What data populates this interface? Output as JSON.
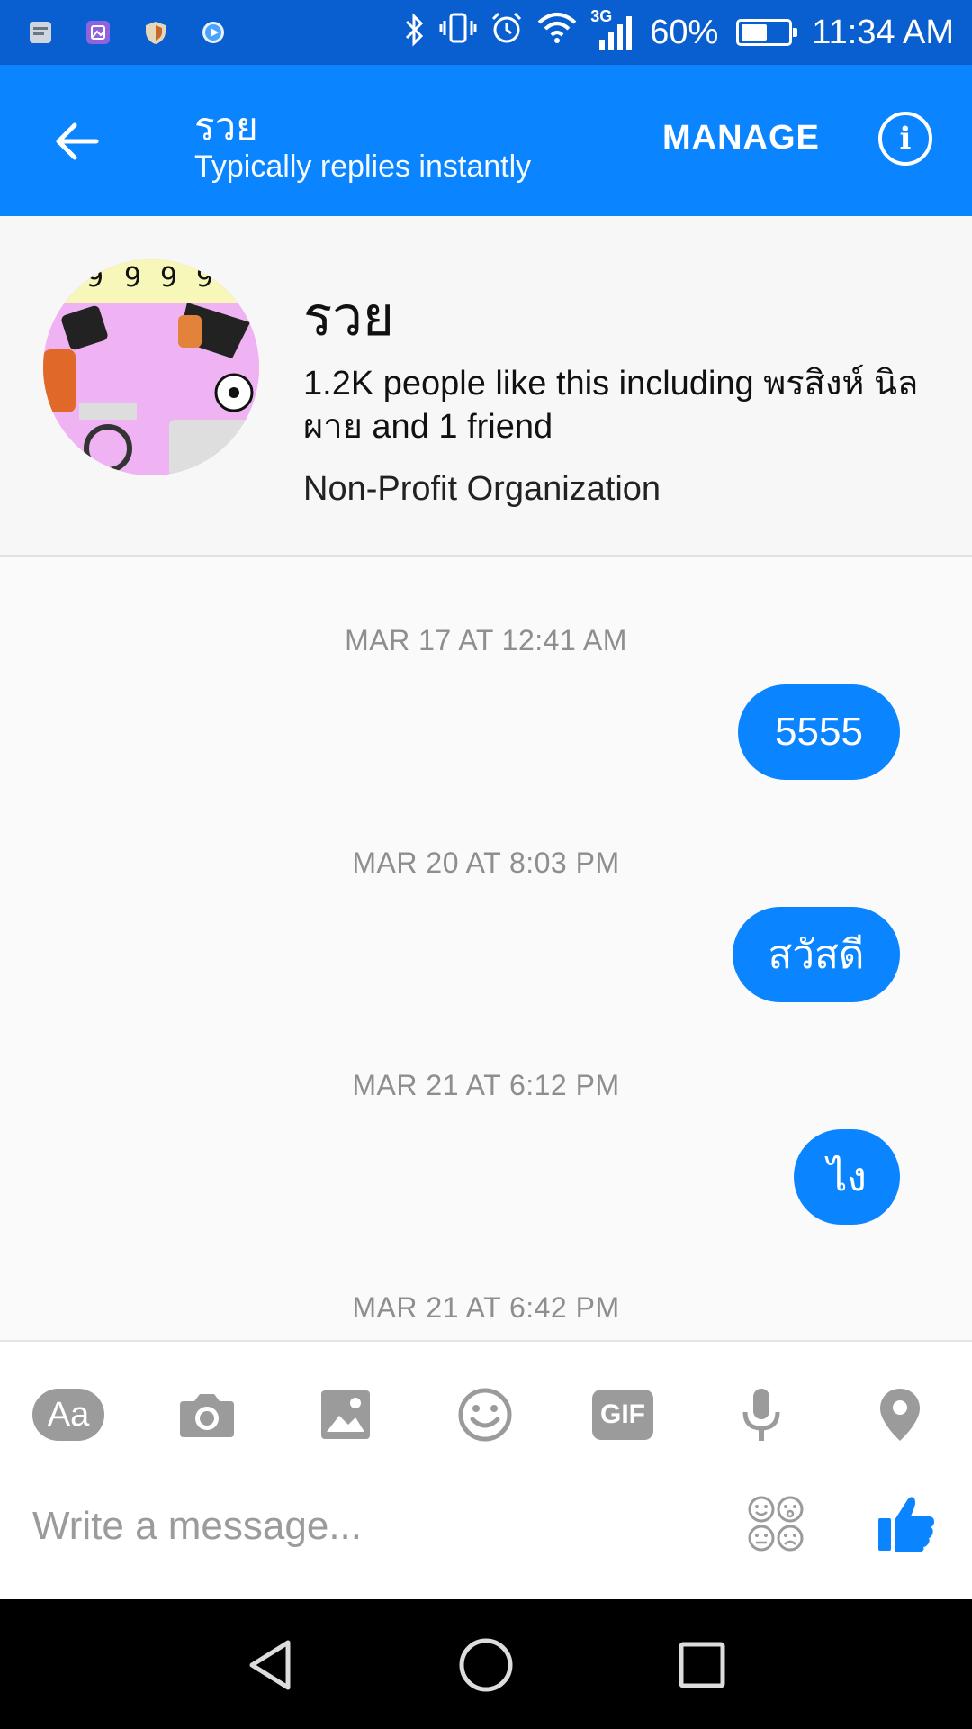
{
  "status_bar": {
    "signal_label": "3G",
    "battery": "60%",
    "battery_level": 0.6,
    "time": "11:34 AM"
  },
  "header": {
    "title": "รวย",
    "subtitle": "Typically replies instantly",
    "manage_label": "MANAGE"
  },
  "profile": {
    "name": "รวย",
    "likes": "1.2K people like this including พรสิงห์ นิลผาย and 1 friend",
    "category": "Non-Profit Organization"
  },
  "messages": [
    {
      "timestamp": "MAR 17 AT 12:41 AM",
      "text": "5555"
    },
    {
      "timestamp": "MAR 20 AT 8:03 PM",
      "text": "สวัสดี"
    },
    {
      "timestamp": "MAR 21 AT 6:12 PM",
      "text": "ไง"
    },
    {
      "timestamp": "MAR 21 AT 6:42 PM",
      "text": ""
    }
  ],
  "composer": {
    "aa_label": "Aa",
    "gif_label": "GIF",
    "placeholder": "Write a message..."
  },
  "colors": {
    "accent": "#0a84ff",
    "status_bar": "#0a5fd0",
    "icon_gray": "#9b9b9b"
  },
  "icons": {
    "back": "arrow-left-icon",
    "info": "info-icon",
    "camera": "camera-icon",
    "image": "image-icon",
    "emoji": "emoji-icon",
    "mic": "microphone-icon",
    "location": "location-pin-icon",
    "stickers": "sticker-icon",
    "like": "thumbs-up-icon"
  }
}
